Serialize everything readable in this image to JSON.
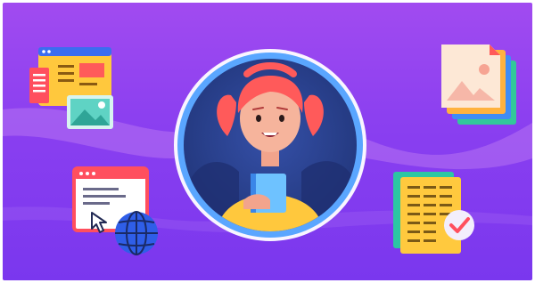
{
  "illustration": {
    "background": {
      "top": "#a14bf0",
      "bottom": "#7a37ee"
    },
    "center": {
      "avatar": "girl-with-book",
      "ring_color": "#5aa6ff",
      "disc_color": "#2b3f8f"
    },
    "icons": [
      "web-page-icon",
      "photo-stack-icon",
      "browser-cursor-globe-icon",
      "spreadsheet-check-icon"
    ]
  }
}
